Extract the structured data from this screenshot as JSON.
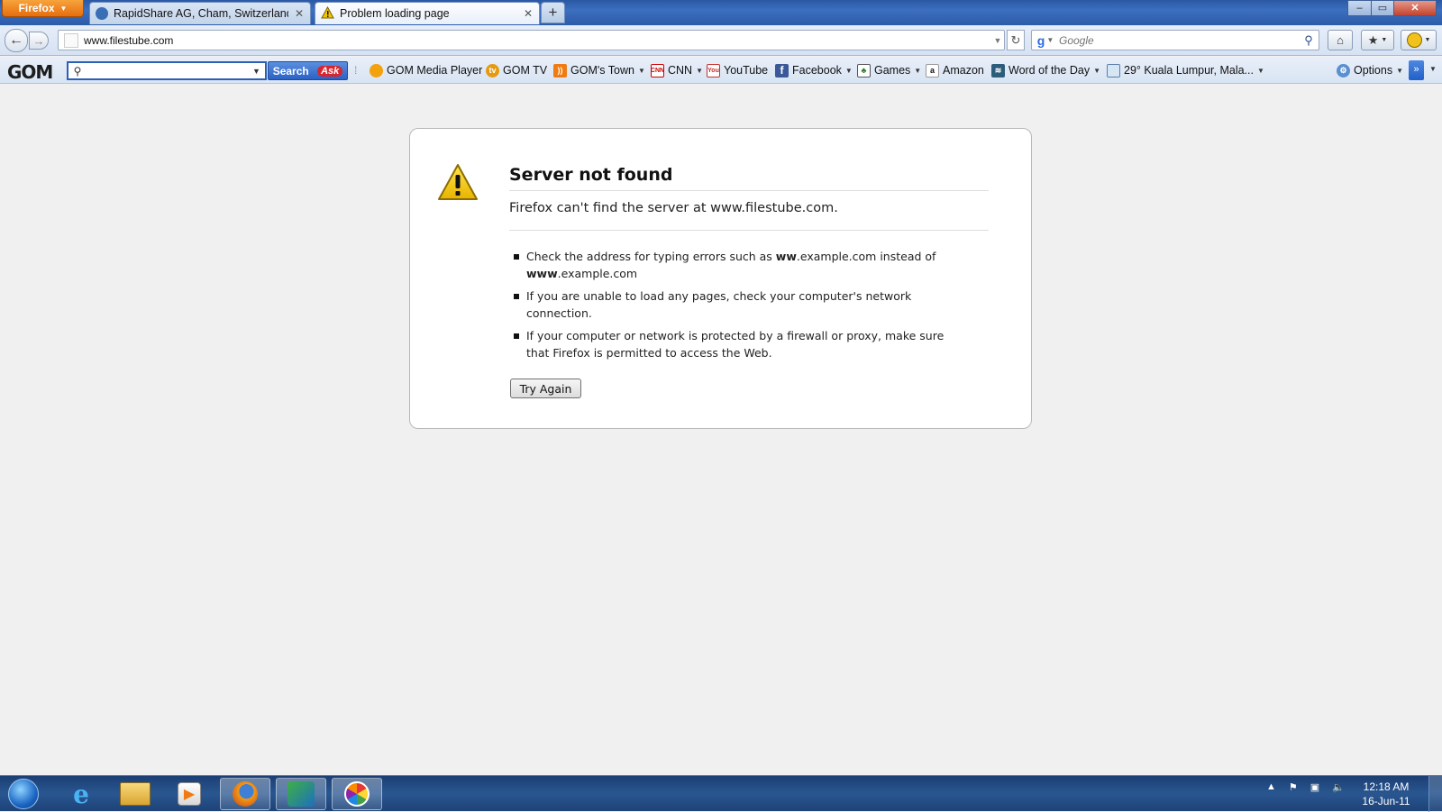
{
  "browser": {
    "menu_button_label": "Firefox",
    "tabs": [
      {
        "label": "RapidShare AG, Cham, Switzerland",
        "active": false
      },
      {
        "label": "Problem loading page",
        "active": true
      }
    ],
    "new_tab_symbol": "+",
    "url": "www.filestube.com",
    "search_placeholder": "Google",
    "window_controls": {
      "minimize": "–",
      "restore": "▭",
      "close": "✕"
    }
  },
  "toolbar": {
    "gom_logo": "GOM",
    "search_button_label": "Search",
    "ask_label": "Ask",
    "bookmarks": [
      {
        "label": "GOM Media Player",
        "icon": "gom-player-icon",
        "dropdown": false
      },
      {
        "label": "GOM TV",
        "icon": "gom-tv-icon",
        "dropdown": false
      },
      {
        "label": "GOM's Town",
        "icon": "rss-icon",
        "dropdown": true
      },
      {
        "label": "CNN",
        "icon": "cnn-icon",
        "dropdown": true
      },
      {
        "label": "YouTube",
        "icon": "youtube-icon",
        "dropdown": false
      },
      {
        "label": "Facebook",
        "icon": "facebook-icon",
        "dropdown": true
      },
      {
        "label": "Games",
        "icon": "games-icon",
        "dropdown": true
      },
      {
        "label": "Amazon",
        "icon": "amazon-icon",
        "dropdown": false
      },
      {
        "label": "Word of the Day",
        "icon": "dictionary-icon",
        "dropdown": true
      },
      {
        "label": "29° Kuala Lumpur, Mala...",
        "icon": "weather-icon",
        "dropdown": true
      }
    ],
    "options_label": "Options",
    "more_symbol": "»"
  },
  "error_page": {
    "title": "Server not found",
    "description": "Firefox can't find the server at www.filestube.com.",
    "tip1_pre": "Check the address for typing errors such as ",
    "tip1_bold1": "ww",
    "tip1_mid": ".example.com instead of ",
    "tip1_bold2": "www",
    "tip1_post": ".example.com",
    "tip2": "If you are unable to load any pages, check your computer's network connection.",
    "tip3": "If your computer or network is protected by a firewall or proxy, make sure that Firefox is permitted to access the Web.",
    "button_label": "Try Again"
  },
  "taskbar": {
    "apps": [
      {
        "name": "internet-explorer-icon",
        "active": false
      },
      {
        "name": "file-explorer-icon",
        "active": false
      },
      {
        "name": "media-player-icon",
        "active": false
      },
      {
        "name": "firefox-icon",
        "active": true
      },
      {
        "name": "download-manager-icon",
        "active": true
      },
      {
        "name": "picasa-icon",
        "active": true
      }
    ],
    "time": "12:18 AM",
    "date": "16-Jun-11"
  },
  "colors": {
    "titlebar": "#2c5ca8",
    "firefox_button": "#e66e0e",
    "ask_button": "#2b62c4",
    "taskbar": "#1d4378"
  }
}
